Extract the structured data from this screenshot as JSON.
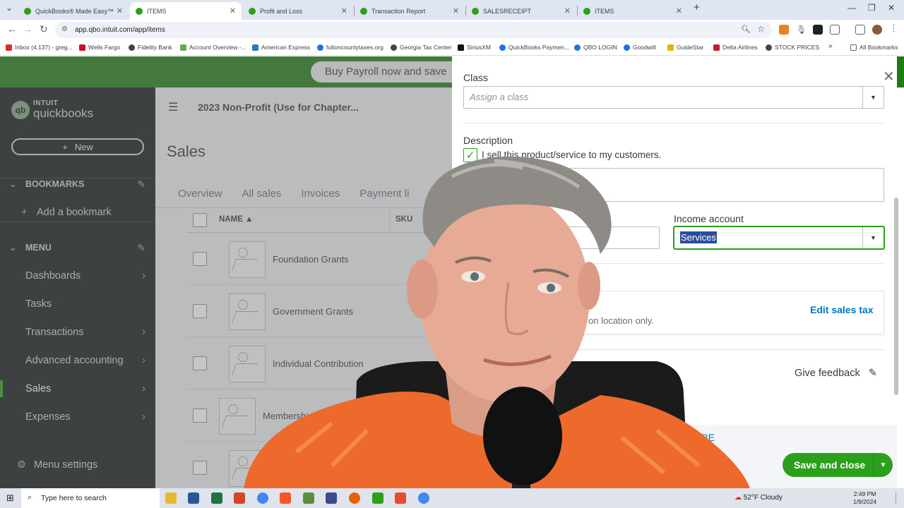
{
  "browser": {
    "tabs": [
      {
        "label": "QuickBooks® Made Easy™ Trai",
        "active": false
      },
      {
        "label": "ITEMS",
        "active": true
      },
      {
        "label": "Profit and Loss",
        "active": false
      },
      {
        "label": "Transaction Report",
        "active": false
      },
      {
        "label": "SALESRECEIPT",
        "active": false
      },
      {
        "label": "ITEMS",
        "active": false
      }
    ],
    "url": "app.qbo.intuit.com/app/items",
    "bookmarks": [
      "Inbox (4,137) - greg...",
      "Wells Fargo",
      "Fidelity Bank",
      "Account Overview -...",
      "American Express",
      "fultoncountytaxes.org",
      "Georgia Tax Center",
      "SiriusXM",
      "QuickBooks Paymen...",
      "QBO LOGIN",
      "Goodwill",
      "GuideStar",
      "Delta Airlines",
      "STOCK PRICES"
    ],
    "all_bookmarks": "All Bookmarks"
  },
  "promo": {
    "text": "Buy Payroll now and save"
  },
  "sidebar": {
    "logo_top": "INTUIT",
    "logo_bottom": "quickbooks",
    "new_label": "New",
    "bookmarks_header": "BOOKMARKS",
    "add_bookmark": "Add a bookmark",
    "menu_header": "MENU",
    "items": [
      {
        "label": "Dashboards",
        "chevron": true
      },
      {
        "label": "Tasks",
        "chevron": false
      },
      {
        "label": "Transactions",
        "chevron": true
      },
      {
        "label": "Advanced accounting",
        "chevron": true
      },
      {
        "label": "Sales",
        "chevron": true
      },
      {
        "label": "Expenses",
        "chevron": true
      }
    ],
    "menu_settings": "Menu settings"
  },
  "main": {
    "company": "2023 Non-Profit (Use for Chapter...",
    "title": "Sales",
    "tabs": [
      "Overview",
      "All sales",
      "Invoices",
      "Payment li"
    ],
    "columns": {
      "name": "NAME",
      "sku": "SKU"
    },
    "rows": [
      {
        "name": "Foundation Grants"
      },
      {
        "name": "Government Grants"
      },
      {
        "name": "Individual Contribution"
      },
      {
        "name": "Membershi"
      }
    ]
  },
  "panel": {
    "class_label": "Class",
    "class_placeholder": "Assign a class",
    "description_label": "Description",
    "sell_checkbox_label": "I sell this product/service to my customers.",
    "income_account_label": "Income account",
    "income_account_value": "Services",
    "tax_note": "on location only.",
    "edit_sales_tax": "Edit sales tax",
    "give_feedback": "Give feedback",
    "show_more": "MORE",
    "save_and_close": "Save and close"
  },
  "taskbar": {
    "search_placeholder": "Type here to search",
    "weather": "52°F  Cloudy",
    "time": "2:49 PM",
    "date": "1/9/2024"
  },
  "colors": {
    "qb_green": "#2ca01c",
    "promo_green": "#1f7a14",
    "sidebar_bg": "#161a1d",
    "link_blue": "#0077c5"
  }
}
